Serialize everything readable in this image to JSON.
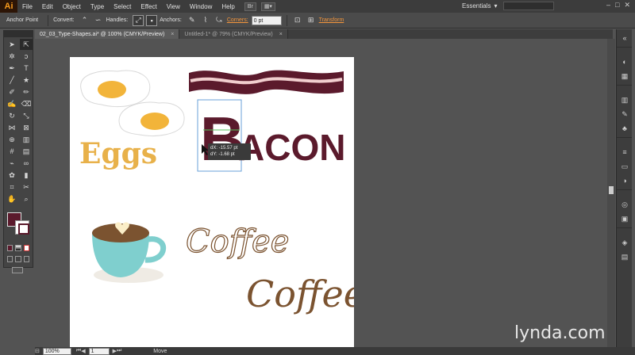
{
  "app": {
    "logo": "Ai"
  },
  "menubar": {
    "items": [
      "File",
      "Edit",
      "Object",
      "Type",
      "Select",
      "Effect",
      "View",
      "Window",
      "Help"
    ],
    "bridge_label": "Br",
    "workspace": "Essentials"
  },
  "controlbar": {
    "anchor_point": "Anchor Point",
    "convert": "Convert:",
    "handles": "Handles:",
    "anchors": "Anchors:",
    "corners": "Corners:",
    "corner_value": "0 pt",
    "transform": "Transform"
  },
  "tabs": [
    {
      "label": "02_03_Type-Shapes.ai* @ 100% (CMYK/Preview)",
      "active": true
    },
    {
      "label": "Untitled-1* @ 79% (CMYK/Preview)",
      "active": false
    }
  ],
  "artboard": {
    "eggs_text": "Eggs",
    "bacon_text": "ACON",
    "bacon_big": "B",
    "coffee_1": "Coffee",
    "coffee_2": "Coffee"
  },
  "tooltip": {
    "dx": "dX: -15.57 pt",
    "dy": "dY: -1.68 pt"
  },
  "statusbar": {
    "zoom": "100%",
    "page": "1",
    "status": "Move"
  },
  "watermark": {
    "text": "lynda",
    "suffix": ".com"
  },
  "colors": {
    "bacon": "#5b1a2c",
    "eggs_text": "#e8b14a",
    "yolk": "#f2b43a",
    "coffee_brown": "#7b5330",
    "cup": "#7fcfce"
  },
  "icons": [
    "selection-tool-icon",
    "direct-selection-tool-icon",
    "pen-tool-icon",
    "type-tool-icon",
    "brush-tool-icon",
    "rotate-tool-icon",
    "zoom-tool-icon",
    "hand-tool-icon"
  ]
}
